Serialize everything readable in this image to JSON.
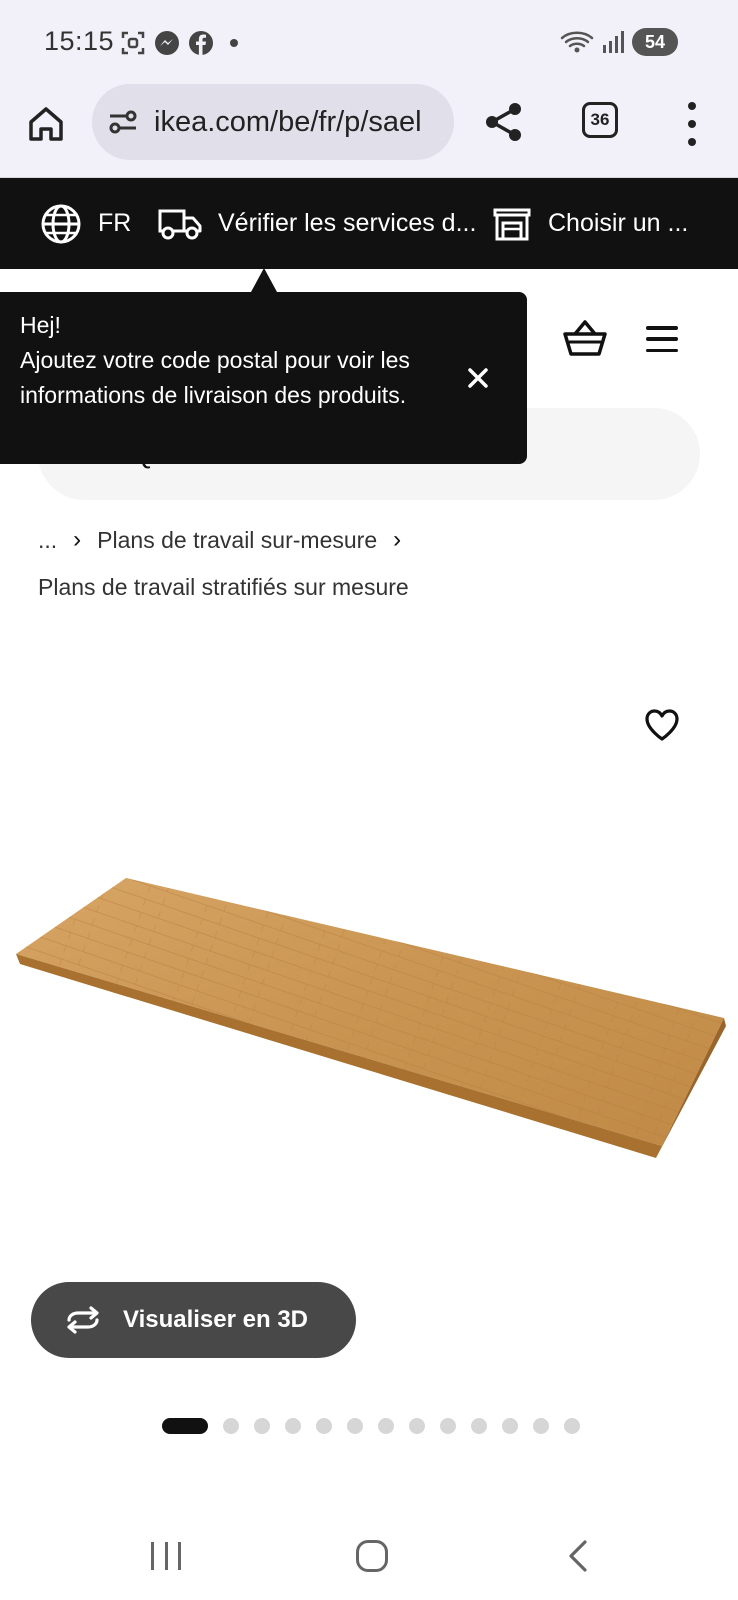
{
  "status_bar": {
    "time": "15:15",
    "battery": "54",
    "icons": [
      "screenshot-icon",
      "messenger-icon",
      "facebook-icon",
      "wifi-icon",
      "signal-icon"
    ]
  },
  "browser": {
    "url": "ikea.com/be/fr/p/sael",
    "tab_count": "36"
  },
  "topbar": {
    "language": "FR",
    "delivery_label": "Vérifier les services d...",
    "store_label": "Choisir un ..."
  },
  "tooltip": {
    "line1": "Hej!",
    "line2": "Ajoutez votre code postal pour voir les informations de livraison des produits."
  },
  "search": {
    "placeholder": "Que cherchez-vous?"
  },
  "breadcrumb": {
    "ellipsis": "...",
    "item1": "Plans de travail sur-mesure",
    "item2": "Plans de travail stratifiés sur mesure"
  },
  "product": {
    "view3d_label": "Visualiser en 3D",
    "image_count": 14,
    "active_image": 1
  },
  "colors": {
    "topbar_bg": "#111111",
    "button_3d_bg": "#484848",
    "browser_bg": "#f2f1f9",
    "wood": "#c98f4a"
  }
}
